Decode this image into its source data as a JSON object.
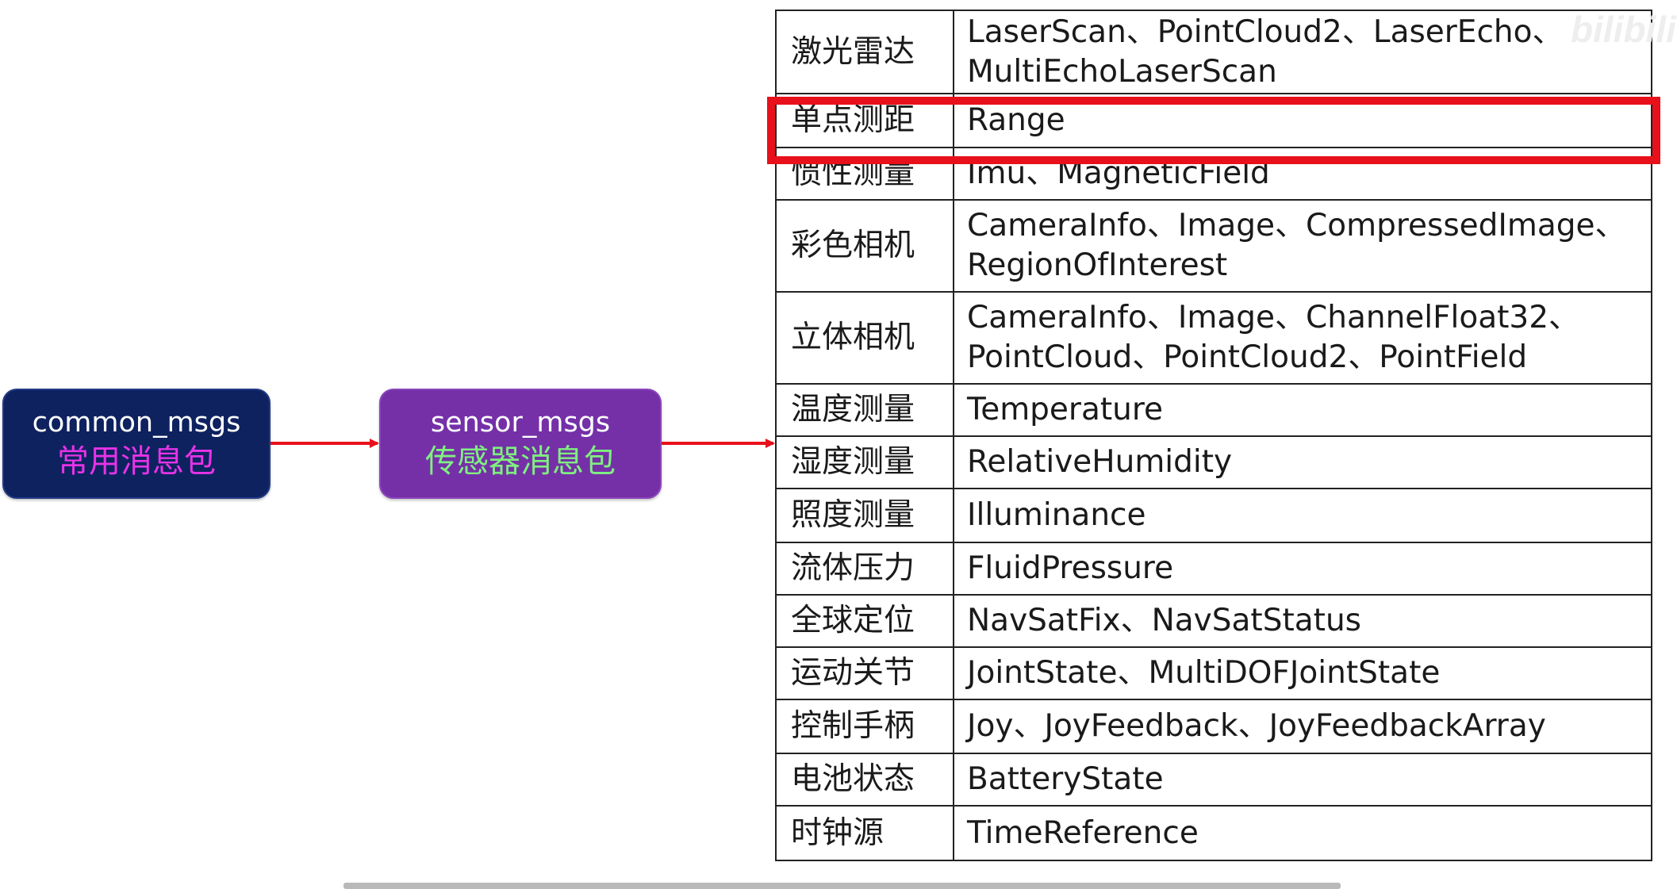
{
  "nodes": [
    {
      "en": "common_msgs",
      "cn": "常用消息包",
      "en_color": "#ffffff",
      "cn_color": "#e733e7"
    },
    {
      "en": "sensor_msgs",
      "cn": "传感器消息包",
      "en_color": "#ffffff",
      "cn_color": "#7ff07f"
    }
  ],
  "edge_color": "#e8101a",
  "rows": [
    {
      "category": "激光雷达",
      "messages": "LaserScan、PointCloud2、LaserEcho、\nMultiEchoLaserScan"
    },
    {
      "category": "单点测距",
      "messages": "Range"
    },
    {
      "category": "惯性测量",
      "messages": "Imu、MagneticField"
    },
    {
      "category": "彩色相机",
      "messages": "CameraInfo、Image、CompressedImage、\nRegionOfInterest"
    },
    {
      "category": "立体相机",
      "messages": "CameraInfo、Image、ChannelFloat32、\nPointCloud、PointCloud2、PointField"
    },
    {
      "category": "温度测量",
      "messages": "Temperature"
    },
    {
      "category": "湿度测量",
      "messages": "RelativeHumidity"
    },
    {
      "category": "照度测量",
      "messages": "Illuminance"
    },
    {
      "category": "流体压力",
      "messages": "FluidPressure"
    },
    {
      "category": "全球定位",
      "messages": "NavSatFix、NavSatStatus"
    },
    {
      "category": "运动关节",
      "messages": "JointState、MultiDOFJointState"
    },
    {
      "category": "控制手柄",
      "messages": "Joy、JoyFeedback、JoyFeedbackArray"
    },
    {
      "category": "电池状态",
      "messages": "BatteryState"
    },
    {
      "category": "时钟源",
      "messages": "TimeReference"
    }
  ],
  "highlighted_row_category": "单点测距",
  "highlight_color": "#e8101a",
  "watermark": "bilibili"
}
